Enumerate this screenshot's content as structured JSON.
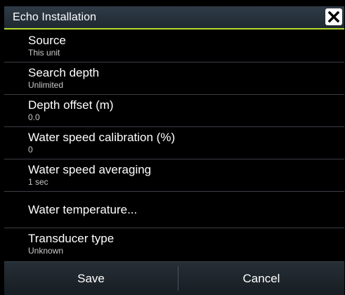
{
  "dialog": {
    "title": "Echo Installation",
    "close_icon": "close-icon"
  },
  "settings": [
    {
      "label": "Source",
      "value": "This unit"
    },
    {
      "label": "Search depth",
      "value": "Unlimited"
    },
    {
      "label": "Depth offset (m)",
      "value": "0.0"
    },
    {
      "label": "Water speed calibration (%)",
      "value": "0"
    },
    {
      "label": "Water speed averaging",
      "value": "1 sec"
    },
    {
      "label": "Water temperature...",
      "value": ""
    },
    {
      "label": "Transducer type",
      "value": "Unknown"
    }
  ],
  "footer": {
    "save_label": "Save",
    "cancel_label": "Cancel"
  },
  "colors": {
    "accent": "#b7dc32",
    "background": "#000000",
    "text": "#ffffff",
    "secondary_text": "#c9c9c9"
  }
}
